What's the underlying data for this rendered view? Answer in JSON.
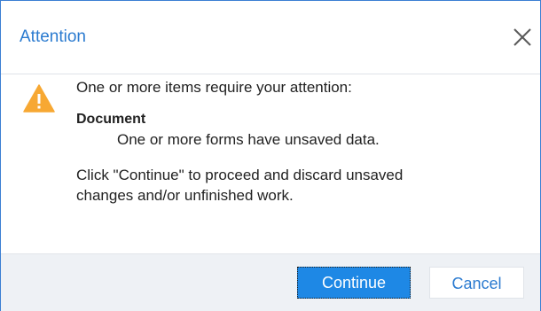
{
  "dialog": {
    "title": "Attention",
    "close_icon": "close-icon",
    "warning_icon": "warning-icon",
    "intro": "One or more items require your attention:",
    "section_heading": "Document",
    "section_detail": "One or more forms have unsaved data.",
    "instructions_line1": "Click \"Continue\" to proceed and discard unsaved",
    "instructions_line2": "changes and/or unfinished work."
  },
  "buttons": {
    "continue_label": "Continue",
    "cancel_label": "Cancel"
  },
  "colors": {
    "accent": "#2b7bd0",
    "primary_button": "#1e88e5",
    "warning": "#f7a833",
    "footer_bg": "#eef1f5"
  }
}
